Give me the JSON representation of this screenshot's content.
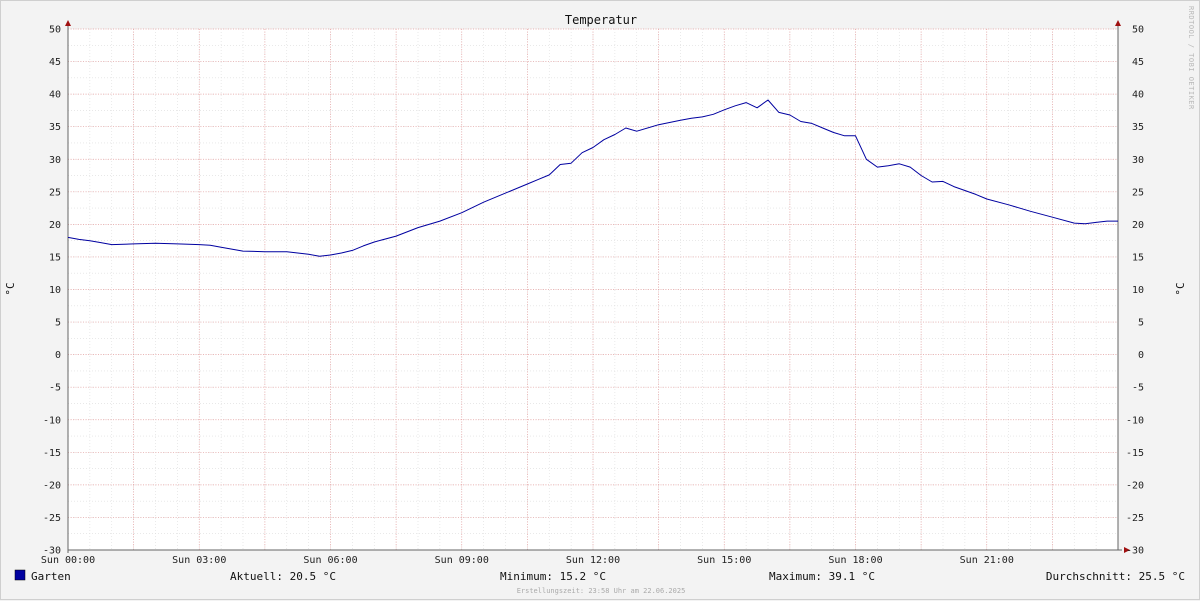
{
  "colors": {
    "series": "#0000a0",
    "legend_swatch": "#0000a0",
    "axis_arrow": "#a01010",
    "major_grid": "#e8a0a0",
    "minor_grid": "#dcdcdc",
    "plot_bg": "#ffffff",
    "page_bg": "#f3f3f3"
  },
  "legend": {
    "series_name": "Garten",
    "current": "Aktuell: 20.5 °C",
    "minimum": "Minimum: 15.2 °C",
    "maximum": "Maximum: 39.1 °C",
    "average": "Durchschnitt: 25.5 °C"
  },
  "footer": "Erstellungszeit: 23:58 Uhr am 22.06.2025",
  "watermark": "RRDTOOL / TOBI OETIKER",
  "chart_data": {
    "type": "line",
    "title": "Temperatur",
    "ylabel": "°C",
    "ylabel_right": "°C",
    "xlabel": "",
    "ylim": [
      -30,
      50
    ],
    "y_ticks": [
      50,
      45,
      40,
      35,
      30,
      25,
      20,
      15,
      10,
      5,
      0,
      -5,
      -10,
      -15,
      -20,
      -25,
      -30
    ],
    "x_range_hours": [
      0,
      24
    ],
    "x_ticks": [
      {
        "hour": 0,
        "label": "Sun 00:00"
      },
      {
        "hour": 3,
        "label": "Sun 03:00"
      },
      {
        "hour": 6,
        "label": "Sun 06:00"
      },
      {
        "hour": 9,
        "label": "Sun 09:00"
      },
      {
        "hour": 12,
        "label": "Sun 12:00"
      },
      {
        "hour": 15,
        "label": "Sun 15:00"
      },
      {
        "hour": 18,
        "label": "Sun 18:00"
      },
      {
        "hour": 21,
        "label": "Sun 21:00"
      }
    ],
    "grid": true,
    "legend_position": "bottom-left",
    "series": [
      {
        "name": "Garten",
        "x": [
          0,
          0.25,
          0.5,
          0.75,
          1.0,
          1.5,
          2.0,
          2.5,
          3.0,
          3.25,
          3.5,
          4.0,
          4.5,
          5.0,
          5.25,
          5.5,
          5.75,
          6.0,
          6.25,
          6.5,
          6.75,
          7.0,
          7.5,
          8.0,
          8.5,
          9.0,
          9.5,
          10.0,
          10.5,
          10.75,
          11.0,
          11.25,
          11.5,
          11.75,
          12.0,
          12.25,
          12.5,
          12.75,
          13.0,
          13.5,
          14.0,
          14.25,
          14.5,
          14.75,
          15.0,
          15.25,
          15.5,
          15.75,
          16.0,
          16.25,
          16.5,
          16.75,
          17.0,
          17.25,
          17.5,
          17.75,
          18.0,
          18.25,
          18.5,
          18.75,
          19.0,
          19.25,
          19.5,
          19.75,
          20.0,
          20.25,
          20.5,
          20.75,
          21.0,
          21.5,
          22.0,
          22.5,
          23.0,
          23.25,
          23.5,
          23.75,
          24.0
        ],
        "y": [
          18.0,
          17.7,
          17.5,
          17.2,
          16.9,
          17.0,
          17.1,
          17.0,
          16.9,
          16.8,
          16.5,
          15.9,
          15.8,
          15.8,
          15.6,
          15.4,
          15.1,
          15.3,
          15.6,
          16.0,
          16.7,
          17.3,
          18.2,
          19.5,
          20.5,
          21.8,
          23.4,
          24.8,
          26.2,
          26.9,
          27.6,
          29.2,
          29.4,
          31.0,
          31.8,
          33.0,
          33.8,
          34.8,
          34.3,
          35.3,
          36.0,
          36.3,
          36.5,
          36.9,
          37.6,
          38.2,
          38.7,
          37.9,
          39.1,
          37.2,
          36.8,
          35.8,
          35.5,
          34.8,
          34.1,
          33.6,
          33.6,
          30.0,
          28.8,
          29.0,
          29.3,
          28.8,
          27.5,
          26.5,
          26.6,
          25.8,
          25.2,
          24.6,
          23.9,
          23.0,
          22.0,
          21.1,
          20.2,
          20.1,
          20.3,
          20.5,
          20.5
        ]
      }
    ]
  }
}
